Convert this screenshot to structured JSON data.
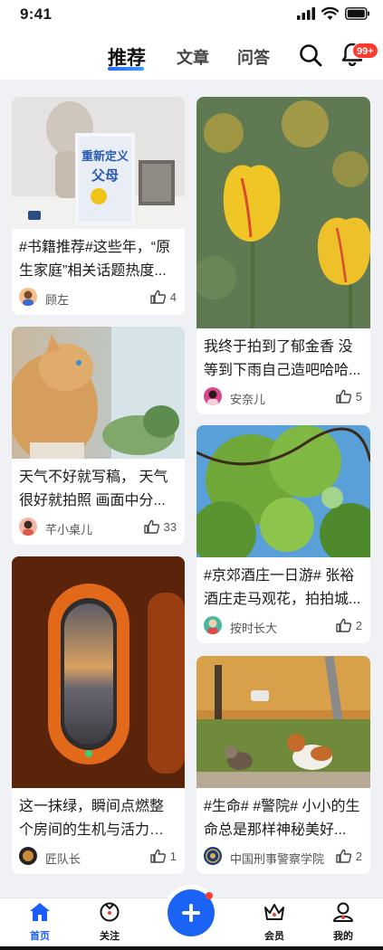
{
  "status_bar": {
    "time": "9:41"
  },
  "top_nav": {
    "tabs": [
      {
        "label": "推荐",
        "active": true
      },
      {
        "label": "文章",
        "active": false
      },
      {
        "label": "问答",
        "active": false
      }
    ],
    "notification_badge": "99+"
  },
  "feed": {
    "left": [
      {
        "title": "#书籍推荐#这些年，“原生家庭”相关话题热度...",
        "author": "顾左",
        "likes": "4",
        "image": "book-cover-photo"
      },
      {
        "title": "天气不好就写稿， 天气很好就拍照 画面中分...",
        "author": "芊小桌儿",
        "likes": "33",
        "image": "cat-by-window-photo"
      },
      {
        "title": "这一抹绿，瞬间点燃整个房间的生机与活力！#...",
        "author": "匠队长",
        "likes": "1",
        "image": "airplane-window-sunset-photo"
      }
    ],
    "right": [
      {
        "title": "我终于拍到了郁金香 没等到下雨自己造吧哈哈...",
        "author": "安奈儿",
        "likes": "5",
        "image": "yellow-tulips-photo"
      },
      {
        "title": "#京郊酒庄一日游# 张裕酒庄走马观花，拍拍城...",
        "author": "按时长大",
        "likes": "2",
        "image": "green-tree-blue-sky-photo"
      },
      {
        "title": "#生命# #警院#  小小的生命总是那样神秘美好...",
        "author": "中国刑事警察学院",
        "likes": "2",
        "image": "cats-on-path-photo"
      }
    ]
  },
  "bottom_nav": {
    "items": [
      {
        "label": "首页",
        "icon": "home-icon",
        "active": true
      },
      {
        "label": "关注",
        "icon": "follow-icon",
        "active": false
      },
      {
        "label": "会员",
        "icon": "member-crown-icon",
        "active": false
      },
      {
        "label": "我的",
        "icon": "profile-icon",
        "active": false
      }
    ],
    "publish_icon": "plus-icon"
  },
  "colors": {
    "accent": "#1a63f5",
    "badge": "#ff3b30",
    "background": "#f0f1f4"
  }
}
